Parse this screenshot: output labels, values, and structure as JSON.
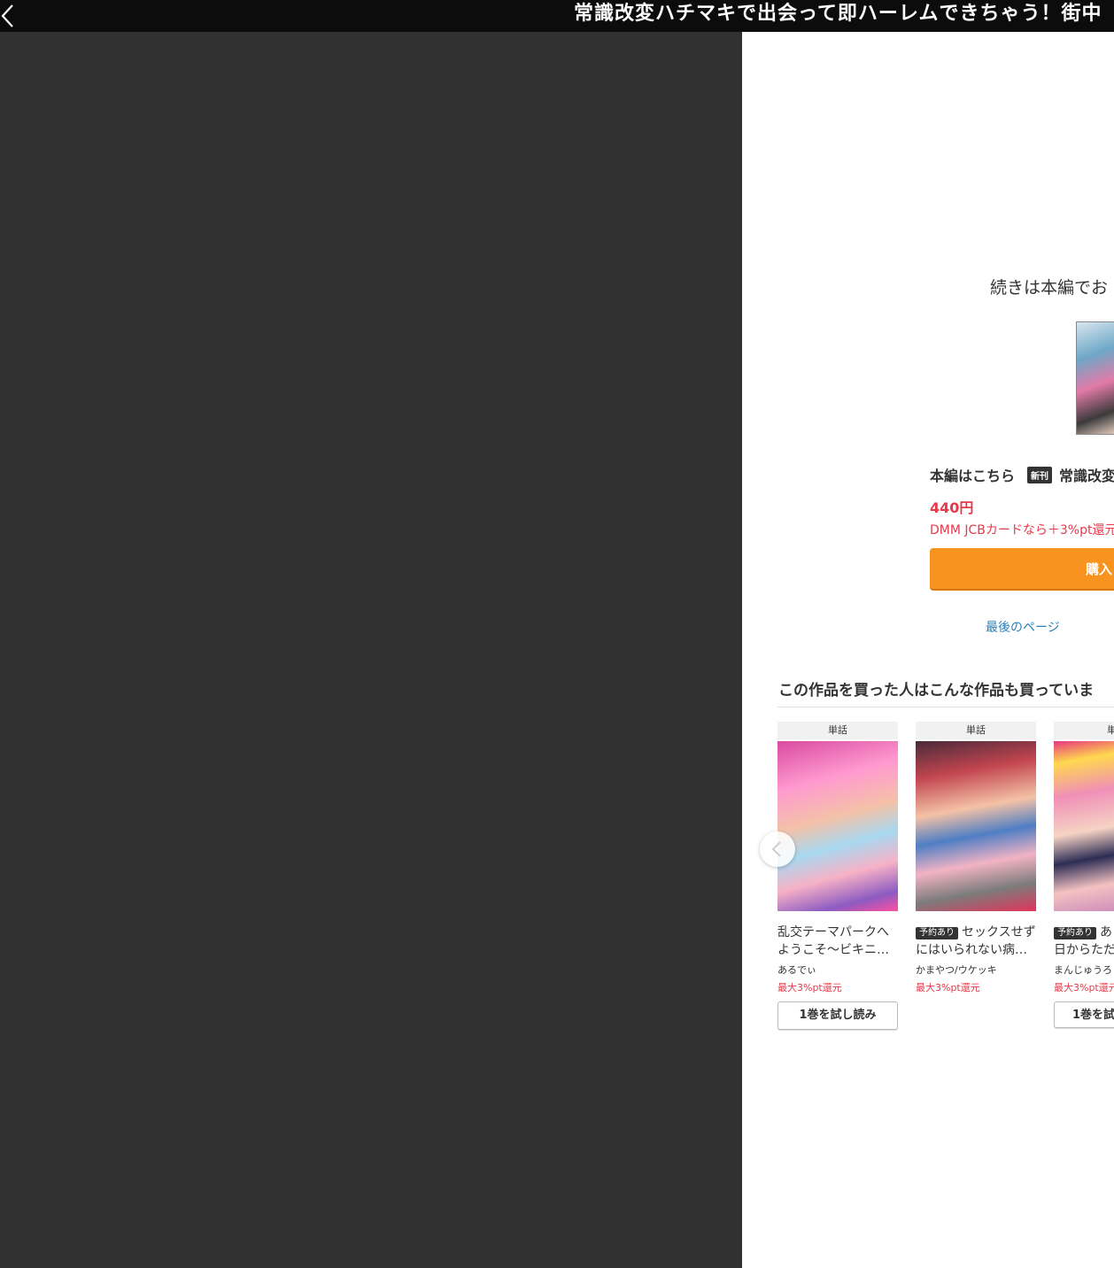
{
  "header": {
    "title": "常識改変ハチマキで出会って即ハーレムできちゃう！街中",
    "back_icon": "chevron-left-icon"
  },
  "endpage": {
    "continue_text": "続きは本編でお",
    "honpen_label": "本編はこちら",
    "new_badge": "新刊",
    "honpen_title": "常識改変ハ",
    "price": "440円",
    "cashback": "DMM JCBカードなら＋3%pt還元",
    "buy_label": "購入",
    "last_page_link": "最後のページ"
  },
  "recommend": {
    "heading": "この作品を買った人はこんな作品も買っていま",
    "items": [
      {
        "type": "単話",
        "reserve_badge": "",
        "title_line1": "乱交テーマパークへ",
        "title_line2": "ようこそ〜ビキニ…",
        "author": "あるでぃ",
        "reward": "最大3%pt還元",
        "trial_label": "1巻を試し読み"
      },
      {
        "type": "単話",
        "reserve_badge": "予約あり",
        "title_line1": "セックスせず",
        "title_line2": "にはいられない病…",
        "author": "かまやつ/ウケッキ",
        "reward": "最大3%pt還元",
        "trial_label": ""
      },
      {
        "type": "単",
        "reserve_badge": "予約あり",
        "title_line1": "あ",
        "title_line2": "日からただ",
        "author": "まんじゅうろ",
        "reward": "最大3%pt還元",
        "trial_label": "1巻を試"
      }
    ],
    "prev_icon": "chevron-left-icon"
  }
}
